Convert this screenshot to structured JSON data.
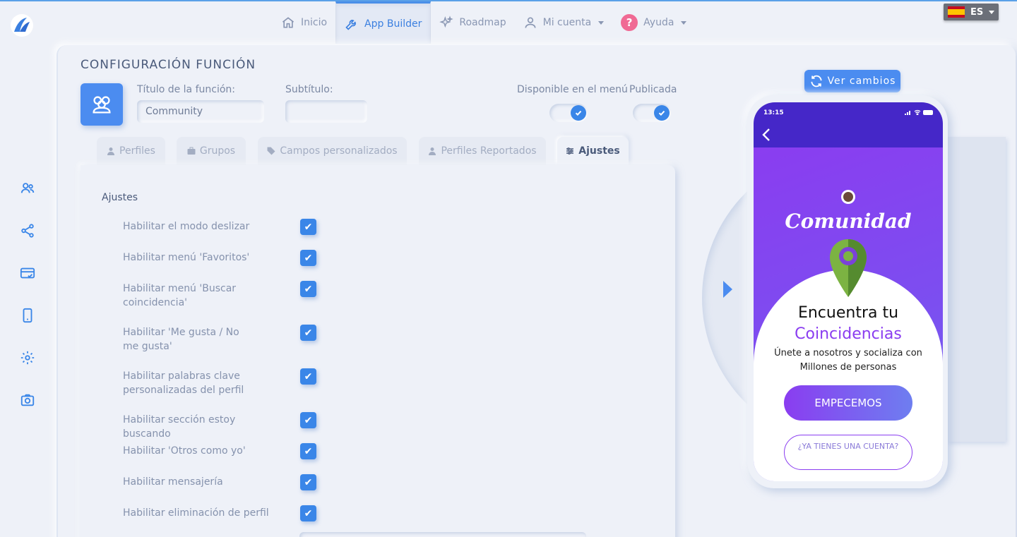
{
  "nav": {
    "items": [
      {
        "label": "Inicio",
        "icon": "home-icon"
      },
      {
        "label": "App Builder",
        "icon": "wrench-icon",
        "active": true
      },
      {
        "label": "Roadmap",
        "icon": "sparkle-icon"
      },
      {
        "label": "Mi cuenta",
        "icon": "user-icon"
      },
      {
        "label": "Ayuda",
        "icon": "help-icon"
      }
    ],
    "help_glyph": "?"
  },
  "language": {
    "code": "ES"
  },
  "page": {
    "title": "CONFIGURACIÓN FUNCIÓN",
    "title_label": "Título de la función:",
    "title_value": "Community",
    "subtitle_label": "Subtítulo:",
    "subtitle_value": "",
    "menu_label": "Disponible en el menú",
    "published_label": "Publicada"
  },
  "tabs": [
    {
      "label": "Perfiles"
    },
    {
      "label": "Grupos"
    },
    {
      "label": "Campos personalizados"
    },
    {
      "label": "Perfiles Reportados"
    },
    {
      "label": "Ajustes",
      "active": true
    }
  ],
  "settings": {
    "title": "Ajustes",
    "items": [
      {
        "label": "Habilitar el modo deslizar",
        "checked": true
      },
      {
        "label": "Habilitar menú 'Favoritos'",
        "checked": true
      },
      {
        "label": "Habilitar menú 'Buscar coincidencia'",
        "checked": true
      },
      {
        "label": "Habilitar 'Me gusta / No me gusta'",
        "checked": true
      },
      {
        "label": "Habilitar palabras clave personalizadas del perfil",
        "checked": true
      },
      {
        "label": "Habilitar sección estoy buscando",
        "checked": true
      },
      {
        "label": "Habilitar 'Otros como yo'",
        "checked": true
      },
      {
        "label": "Habilitar mensajería",
        "checked": true
      },
      {
        "label": "Habilitar eliminación de perfil",
        "checked": true
      }
    ],
    "check_glyph": "✔"
  },
  "preview": {
    "button_label": "Ver cambios",
    "time": "13:15",
    "app_title": "Comunidad",
    "heading": "Encuentra tu",
    "heading_accent": "Coincidencias",
    "subtext": "Únete a nosotros y socializa con Millones de personas",
    "start_button": "EMPECEMOS",
    "account_button": "¿YA TIENES UNA CUENTA?"
  },
  "colors": {
    "accent": "#4b8cf0",
    "purple": "#8a3df0",
    "status_bar": "#4527c8"
  }
}
